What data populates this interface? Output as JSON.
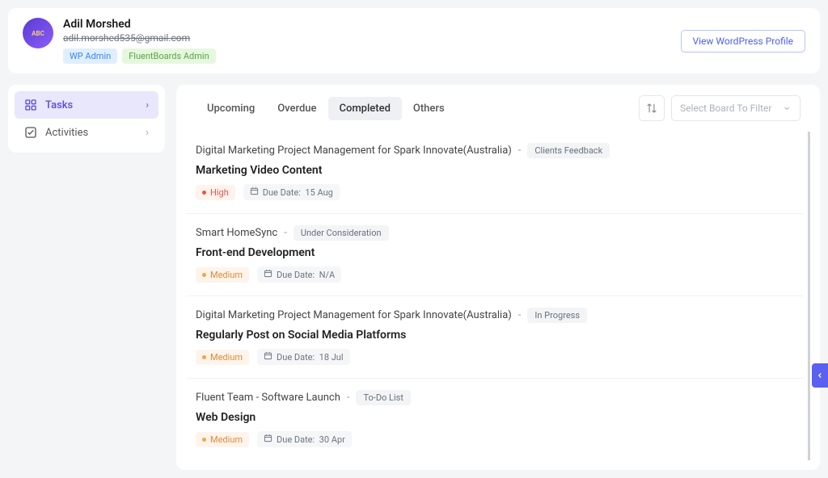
{
  "profile": {
    "name": "Adil Morshed",
    "email": "adil.morshed535@gmail.com",
    "tags": {
      "wp": "WP Admin",
      "fb": "FluentBoards Admin"
    }
  },
  "header": {
    "viewProfile": "View WordPress Profile"
  },
  "sidebar": {
    "items": [
      {
        "label": "Tasks",
        "active": true
      },
      {
        "label": "Activities",
        "active": false
      }
    ]
  },
  "tabs": {
    "items": [
      "Upcoming",
      "Overdue",
      "Completed",
      "Others"
    ],
    "activeIndex": 2
  },
  "boardSelect": {
    "placeholder": "Select Board To Filter"
  },
  "tasks": [
    {
      "project": "Digital Marketing Project Management for Spark Innovate(Australia)",
      "stage": "Clients Feedback",
      "title": "Marketing Video Content",
      "priority": "High",
      "priorityClass": "high",
      "due": "15 Aug"
    },
    {
      "project": "Smart HomeSync",
      "stage": "Under Consideration",
      "title": "Front-end Development",
      "priority": "Medium",
      "priorityClass": "medium",
      "due": "N/A"
    },
    {
      "project": "Digital Marketing Project Management for Spark Innovate(Australia)",
      "stage": "In Progress",
      "title": "Regularly Post on Social Media Platforms",
      "priority": "Medium",
      "priorityClass": "medium",
      "due": "18 Jul"
    },
    {
      "project": "Fluent Team - Software Launch",
      "stage": "To-Do List",
      "title": "Web Design",
      "priority": "Medium",
      "priorityClass": "medium",
      "due": "30 Apr"
    }
  ],
  "labels": {
    "dueDate": "Due Date:"
  }
}
